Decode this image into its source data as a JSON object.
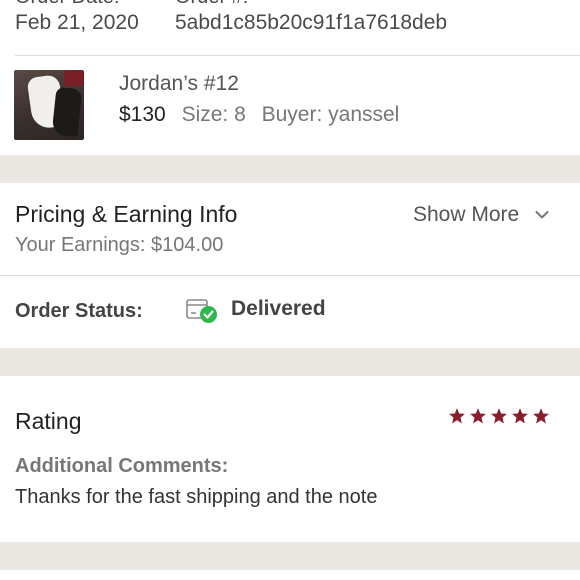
{
  "order": {
    "date_label": "Order Date:",
    "id_label": "Order #:",
    "date": "Feb 21, 2020",
    "id": "5abd1c85b20c91f1a7618deb"
  },
  "item": {
    "thumbnail_icon": "sneaker-photo",
    "name": "Jordan’s #12",
    "price": "$130",
    "size_label": "Size: 8",
    "buyer_label": "Buyer: yanssel"
  },
  "pricing": {
    "title": "Pricing & Earning Info",
    "show_more": "Show More",
    "earnings": "Your Earnings: $104.00",
    "chevron_icon": "chevron-down-icon"
  },
  "status": {
    "label": "Order Status:",
    "value": "Delivered",
    "icon": "package-delivered-icon",
    "check_color": "#2db84d"
  },
  "rating": {
    "title": "Rating",
    "stars": 5,
    "star_color": "#8b1e2e",
    "comments_label": "Additional Comments:",
    "comment": "Thanks for the fast shipping and the note"
  },
  "colors": {
    "gap_background": "#ebe8e4",
    "brand_maroon": "#8b1e2e"
  }
}
